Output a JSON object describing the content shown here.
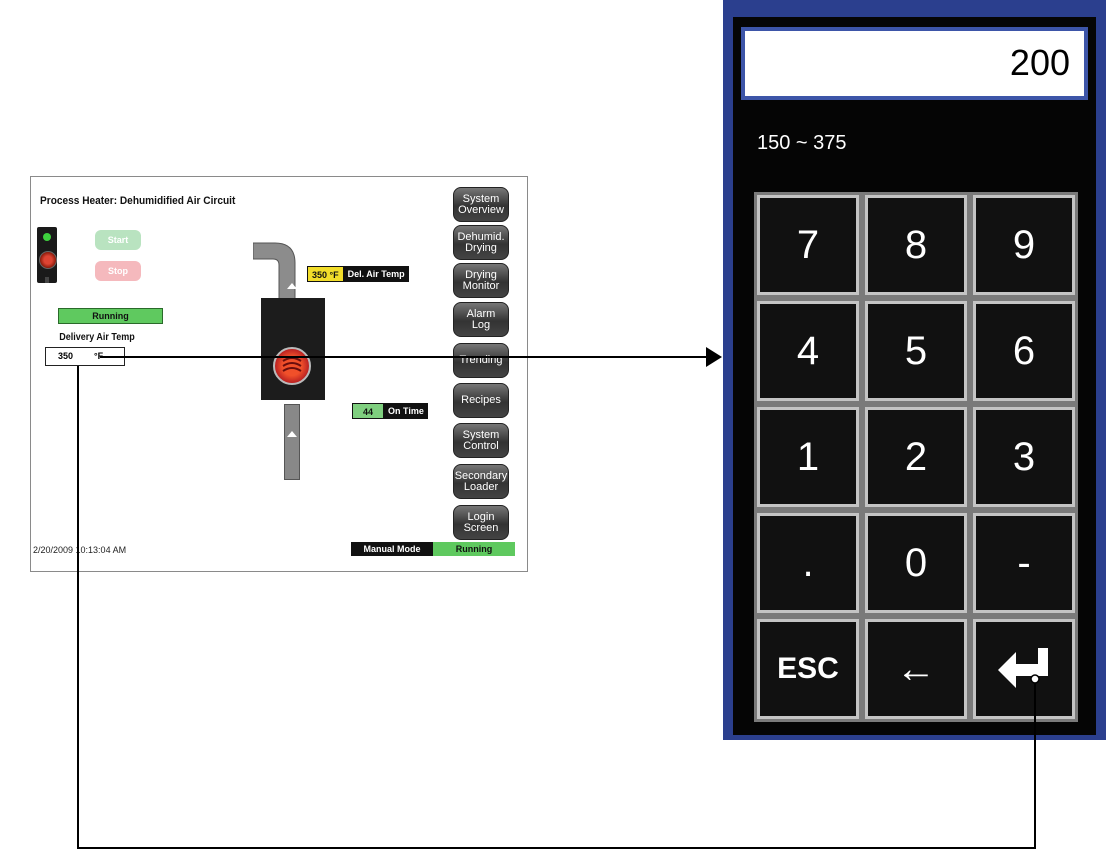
{
  "hmi": {
    "title": "Process Heater: Dehumidified Air Circuit",
    "start_label": "Start",
    "stop_label": "Stop",
    "status": "Running",
    "delivery_label": "Delivery Air Temp",
    "delivery_value": "350",
    "delivery_unit": "°F",
    "diagram": {
      "temp_value": "350 °F",
      "temp_label": "Del. Air Temp",
      "ontime_value": "44",
      "ontime_label": "On Time"
    },
    "nav": [
      "System\nOverview",
      "Dehumid.\nDrying",
      "Drying\nMonitor",
      "Alarm\nLog",
      "Trending",
      "Recipes",
      "System\nControl",
      "Secondary\nLoader",
      "Login\nScreen"
    ],
    "timestamp": "2/20/2009 10:13:04 AM",
    "mode": "Manual Mode",
    "mode_status": "Running"
  },
  "keypad": {
    "display_value": "200",
    "range": "150 ~ 375",
    "keys": [
      "7",
      "8",
      "9",
      "4",
      "5",
      "6",
      "1",
      "2",
      "3",
      ".",
      "0",
      "-",
      "ESC",
      "←",
      ""
    ],
    "enter_icon": "enter-icon"
  }
}
